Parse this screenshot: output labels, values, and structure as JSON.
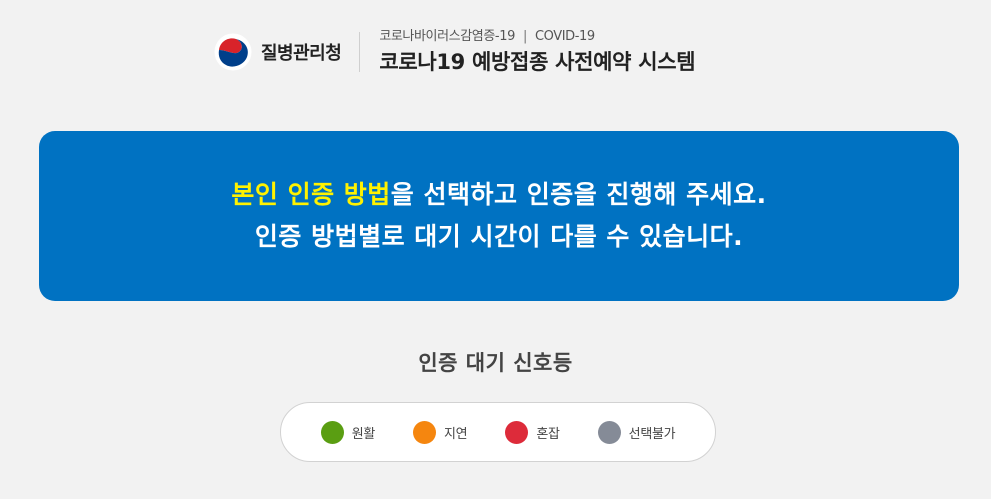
{
  "header": {
    "org_name": "질병관리청",
    "subtitle_ko": "코로나바이러스감염증-19",
    "subtitle_sep": "|",
    "subtitle_en": "COVID-19",
    "title": "코로나19 예방접종 사전예약 시스템"
  },
  "notice": {
    "line1_highlight": "본인 인증 방법",
    "line1_rest": "을 선택하고 인증을 진행해 주세요.",
    "line2": "인증 방법별로 대기 시간이 다를 수 있습니다.",
    "highlight_color": "#fff200",
    "background_color": "#0072c2"
  },
  "signal": {
    "title": "인증 대기 신호등",
    "items": [
      {
        "label": "원활",
        "color": "#5a9e12",
        "icon": "green-circle-icon"
      },
      {
        "label": "지연",
        "color": "#f5860f",
        "icon": "orange-circle-icon"
      },
      {
        "label": "혼잡",
        "color": "#dd2b3a",
        "icon": "red-circle-icon"
      },
      {
        "label": "선택불가",
        "color": "#858b97",
        "icon": "gray-circle-icon"
      }
    ]
  }
}
